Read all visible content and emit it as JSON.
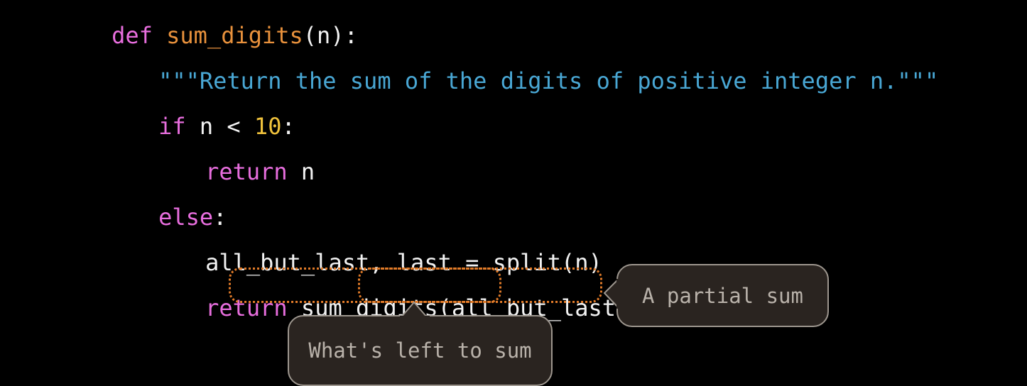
{
  "editor": {
    "background": "#000000",
    "default_text_color": "#f2f2f2",
    "theme_colors": {
      "keyword": "#e86ede",
      "function": "#e8913c",
      "string": "#49a7d4",
      "number": "#f0c23c",
      "plain": "#f2f2f2",
      "highlight_outline": "#e07a28",
      "callout_fill": "#2a2420",
      "callout_border": "#9d968e",
      "callout_text": "#b9b2aa"
    }
  },
  "code": {
    "language": "python",
    "full_source": "def sum_digits(n):\n    \"\"\"Return the sum of the digits of positive integer n.\"\"\"\n    if n < 10:\n        return n\n    else:\n        all_but_last, last = split(n)\n        return sum_digits(all_but_last) + last",
    "lines": [
      {
        "id": "line-def",
        "tokens": [
          {
            "text": "def ",
            "type": "keyword"
          },
          {
            "text": "sum_digits",
            "type": "function"
          },
          {
            "text": "(n):",
            "type": "plain"
          }
        ]
      },
      {
        "id": "line-docstring",
        "tokens": [
          {
            "text": "\"\"\"Return the sum of the digits of positive integer n.\"\"\"",
            "type": "string"
          }
        ]
      },
      {
        "id": "line-if",
        "tokens": [
          {
            "text": "if",
            "type": "keyword"
          },
          {
            "text": " n < ",
            "type": "plain"
          },
          {
            "text": "10",
            "type": "number"
          },
          {
            "text": ":",
            "type": "plain"
          }
        ]
      },
      {
        "id": "line-return-n",
        "tokens": [
          {
            "text": "return",
            "type": "keyword"
          },
          {
            "text": " n",
            "type": "plain"
          }
        ]
      },
      {
        "id": "line-else",
        "tokens": [
          {
            "text": "else",
            "type": "keyword"
          },
          {
            "text": ":",
            "type": "plain"
          }
        ]
      },
      {
        "id": "line-split",
        "tokens": [
          {
            "text": "all_but_last, last = split(n)",
            "type": "plain"
          }
        ]
      },
      {
        "id": "line-return-recursive",
        "tokens": [
          {
            "text": "return",
            "type": "keyword"
          },
          {
            "text": " sum_digits(all_but_last) + last",
            "type": "plain"
          }
        ]
      }
    ]
  },
  "highlights": [
    {
      "id": "outer-highlight",
      "label": "sum_digits(all_but_last) + last",
      "style": "dotted",
      "color": "#e07a28"
    },
    {
      "id": "inner-highlight",
      "label": "all_but_last",
      "style": "dotted",
      "color": "#e07a28"
    }
  ],
  "callouts": [
    {
      "id": "callout-partial-sum",
      "text": "A partial sum",
      "points_to": "outer-highlight",
      "tail_direction": "left"
    },
    {
      "id": "callout-whats-left",
      "text": "What's left to sum",
      "points_to": "inner-highlight",
      "tail_direction": "up"
    }
  ]
}
